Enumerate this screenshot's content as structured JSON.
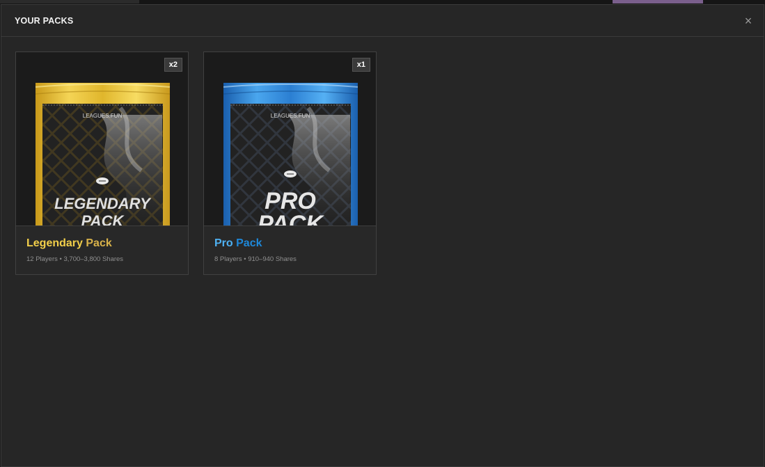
{
  "modal": {
    "title": "YOUR PACKS",
    "close_icon": "close-icon",
    "close_glyph": "×"
  },
  "packs": [
    {
      "name_first": "Legendary",
      "name_second": "Pack",
      "subtitle": "12 Players • 3,700–3,800 Shares",
      "count": "x2",
      "image_brand": "LEAGUES.FUN",
      "image_line1": "LEGENDARY",
      "image_line2": "PACK",
      "accent": "#e3b82a"
    },
    {
      "name_first": "Pro",
      "name_second": "Pack",
      "subtitle": "8 Players • 910–940 Shares",
      "count": "x1",
      "image_brand": "LEAGUES.FUN",
      "image_line1": "PRO",
      "image_line2": "PACK",
      "accent": "#2f7fd0"
    }
  ]
}
